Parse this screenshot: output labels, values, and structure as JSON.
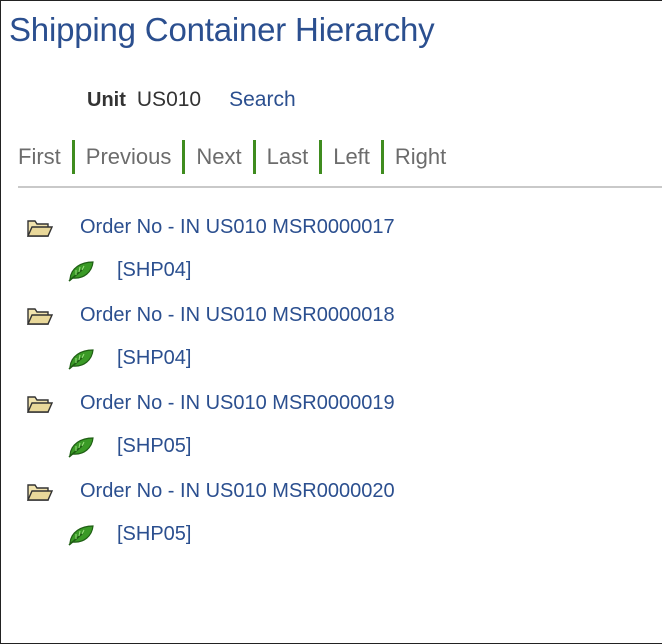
{
  "header": {
    "title": "Shipping Container Hierarchy"
  },
  "unit": {
    "label": "Unit",
    "value": "US010",
    "search_label": "Search"
  },
  "nav": {
    "first": "First",
    "previous": "Previous",
    "next": "Next",
    "last": "Last",
    "left": "Left",
    "right": "Right"
  },
  "tree": {
    "orders": [
      {
        "label": "Order No - IN US010 MSR0000017",
        "container": "[SHP04]"
      },
      {
        "label": "Order No - IN US010 MSR0000018",
        "container": "[SHP04]"
      },
      {
        "label": "Order No - IN US010 MSR0000019",
        "container": "[SHP05]"
      },
      {
        "label": "Order No - IN US010 MSR0000020",
        "container": "[SHP05]"
      }
    ]
  },
  "icons": {
    "folder": "open-folder-icon",
    "leaf": "leaf-icon"
  },
  "colors": {
    "link": "#2b4f8f",
    "separator": "#3f8c1f",
    "leaf": "#3a9a26",
    "folder": "#e9d89a"
  }
}
